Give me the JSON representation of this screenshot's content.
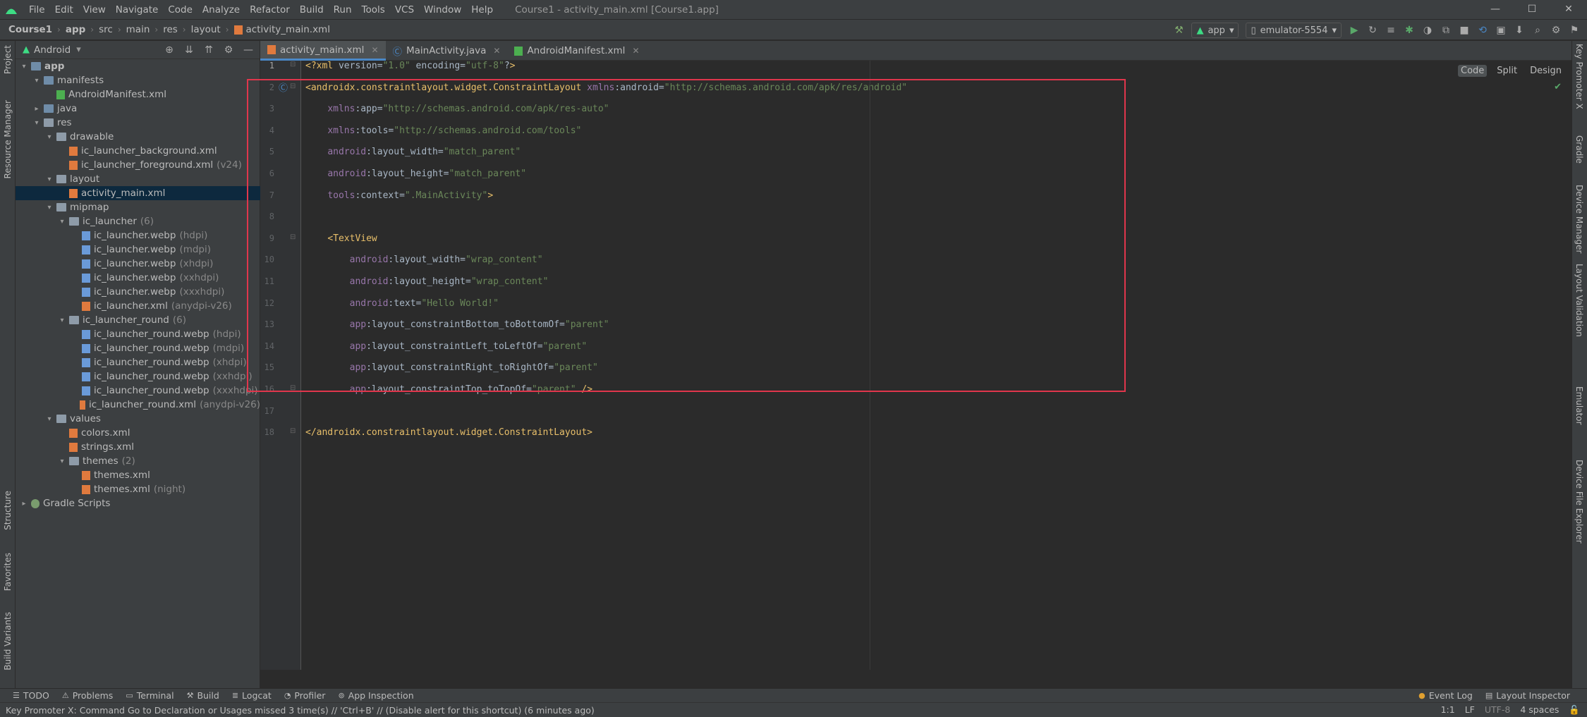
{
  "menu": [
    "File",
    "Edit",
    "View",
    "Navigate",
    "Code",
    "Analyze",
    "Refactor",
    "Build",
    "Run",
    "Tools",
    "VCS",
    "Window",
    "Help"
  ],
  "window_title": "Course1 - activity_main.xml [Course1.app]",
  "breadcrumbs": [
    "Course1",
    "app",
    "src",
    "main",
    "res",
    "layout",
    "activity_main.xml"
  ],
  "toolbar": {
    "config": "app",
    "device": "emulator-5554"
  },
  "project_panel": {
    "title": "Android",
    "tree": [
      {
        "label": "app",
        "depth": 0,
        "arrow": "▾",
        "icon": "folder-blue",
        "bold": true
      },
      {
        "label": "manifests",
        "depth": 1,
        "arrow": "▾",
        "icon": "folder-blue"
      },
      {
        "label": "AndroidManifest.xml",
        "depth": 2,
        "arrow": "",
        "icon": "xml-green"
      },
      {
        "label": "java",
        "depth": 1,
        "arrow": "▸",
        "icon": "folder-blue"
      },
      {
        "label": "res",
        "depth": 1,
        "arrow": "▾",
        "icon": "folder"
      },
      {
        "label": "drawable",
        "depth": 2,
        "arrow": "▾",
        "icon": "folder"
      },
      {
        "label": "ic_launcher_background.xml",
        "depth": 3,
        "arrow": "",
        "icon": "xml"
      },
      {
        "label": "ic_launcher_foreground.xml",
        "depth": 3,
        "arrow": "",
        "icon": "xml",
        "suffix": "(v24)"
      },
      {
        "label": "layout",
        "depth": 2,
        "arrow": "▾",
        "icon": "folder"
      },
      {
        "label": "activity_main.xml",
        "depth": 3,
        "arrow": "",
        "icon": "xml",
        "selected": true
      },
      {
        "label": "mipmap",
        "depth": 2,
        "arrow": "▾",
        "icon": "folder"
      },
      {
        "label": "ic_launcher",
        "depth": 3,
        "arrow": "▾",
        "icon": "folder",
        "suffix": "(6)"
      },
      {
        "label": "ic_launcher.webp",
        "depth": 4,
        "arrow": "",
        "icon": "img",
        "suffix": "(hdpi)"
      },
      {
        "label": "ic_launcher.webp",
        "depth": 4,
        "arrow": "",
        "icon": "img",
        "suffix": "(mdpi)"
      },
      {
        "label": "ic_launcher.webp",
        "depth": 4,
        "arrow": "",
        "icon": "img",
        "suffix": "(xhdpi)"
      },
      {
        "label": "ic_launcher.webp",
        "depth": 4,
        "arrow": "",
        "icon": "img",
        "suffix": "(xxhdpi)"
      },
      {
        "label": "ic_launcher.webp",
        "depth": 4,
        "arrow": "",
        "icon": "img",
        "suffix": "(xxxhdpi)"
      },
      {
        "label": "ic_launcher.xml",
        "depth": 4,
        "arrow": "",
        "icon": "xml",
        "suffix": "(anydpi-v26)"
      },
      {
        "label": "ic_launcher_round",
        "depth": 3,
        "arrow": "▾",
        "icon": "folder",
        "suffix": "(6)"
      },
      {
        "label": "ic_launcher_round.webp",
        "depth": 4,
        "arrow": "",
        "icon": "img",
        "suffix": "(hdpi)"
      },
      {
        "label": "ic_launcher_round.webp",
        "depth": 4,
        "arrow": "",
        "icon": "img",
        "suffix": "(mdpi)"
      },
      {
        "label": "ic_launcher_round.webp",
        "depth": 4,
        "arrow": "",
        "icon": "img",
        "suffix": "(xhdpi)"
      },
      {
        "label": "ic_launcher_round.webp",
        "depth": 4,
        "arrow": "",
        "icon": "img",
        "suffix": "(xxhdpi)"
      },
      {
        "label": "ic_launcher_round.webp",
        "depth": 4,
        "arrow": "",
        "icon": "img",
        "suffix": "(xxxhdpi)"
      },
      {
        "label": "ic_launcher_round.xml",
        "depth": 4,
        "arrow": "",
        "icon": "xml",
        "suffix": "(anydpi-v26)"
      },
      {
        "label": "values",
        "depth": 2,
        "arrow": "▾",
        "icon": "folder"
      },
      {
        "label": "colors.xml",
        "depth": 3,
        "arrow": "",
        "icon": "xml"
      },
      {
        "label": "strings.xml",
        "depth": 3,
        "arrow": "",
        "icon": "xml"
      },
      {
        "label": "themes",
        "depth": 3,
        "arrow": "▾",
        "icon": "folder",
        "suffix": "(2)"
      },
      {
        "label": "themes.xml",
        "depth": 4,
        "arrow": "",
        "icon": "xml"
      },
      {
        "label": "themes.xml",
        "depth": 4,
        "arrow": "",
        "icon": "xml",
        "suffix": "(night)"
      },
      {
        "label": "Gradle Scripts",
        "depth": 0,
        "arrow": "▸",
        "icon": "gradle"
      }
    ]
  },
  "left_stripe": [
    "Project",
    "Resource Manager",
    "Structure",
    "Favorites",
    "Build Variants"
  ],
  "right_stripe": [
    "Key Promoter X",
    "Gradle",
    "Device Manager",
    "Layout Validation",
    "Emulator",
    "Device File Explorer"
  ],
  "tabs": [
    {
      "label": "activity_main.xml",
      "icon": "xml",
      "active": true
    },
    {
      "label": "MainActivity.java",
      "icon": "class",
      "active": false
    },
    {
      "label": "AndroidManifest.xml",
      "icon": "xml-green",
      "active": false
    }
  ],
  "view_modes": [
    "Code",
    "Split",
    "Design"
  ],
  "code_lines": [
    "<?xml version=\"1.0\" encoding=\"utf-8\"?>",
    "<androidx.constraintlayout.widget.ConstraintLayout xmlns:android=\"http://schemas.android.com/apk/res/android\"",
    "    xmlns:app=\"http://schemas.android.com/apk/res-auto\"",
    "    xmlns:tools=\"http://schemas.android.com/tools\"",
    "    android:layout_width=\"match_parent\"",
    "    android:layout_height=\"match_parent\"",
    "    tools:context=\".MainActivity\">",
    "",
    "    <TextView",
    "        android:layout_width=\"wrap_content\"",
    "        android:layout_height=\"wrap_content\"",
    "        android:text=\"Hello World!\"",
    "        app:layout_constraintBottom_toBottomOf=\"parent\"",
    "        app:layout_constraintLeft_toLeftOf=\"parent\"",
    "        app:layout_constraintRight_toRightOf=\"parent\"",
    "        app:layout_constraintTop_toTopOf=\"parent\" />",
    "",
    "</androidx.constraintlayout.widget.ConstraintLayout>"
  ],
  "bottom_tools": [
    "TODO",
    "Problems",
    "Terminal",
    "Build",
    "Logcat",
    "Profiler",
    "App Inspection"
  ],
  "bottom_tools_right": [
    "Event Log",
    "Layout Inspector"
  ],
  "status": {
    "message": "Key Promoter X: Command Go to Declaration or Usages missed 3 time(s) // 'Ctrl+B' // (Disable alert for this shortcut) (6 minutes ago)",
    "position": "1:1",
    "line_sep": "LF",
    "encoding": "UTF-8",
    "indent": "4 spaces"
  },
  "colors": {
    "accent": "#4a88c7",
    "highlight_box": "#e0364c",
    "selection": "#0d293e"
  }
}
